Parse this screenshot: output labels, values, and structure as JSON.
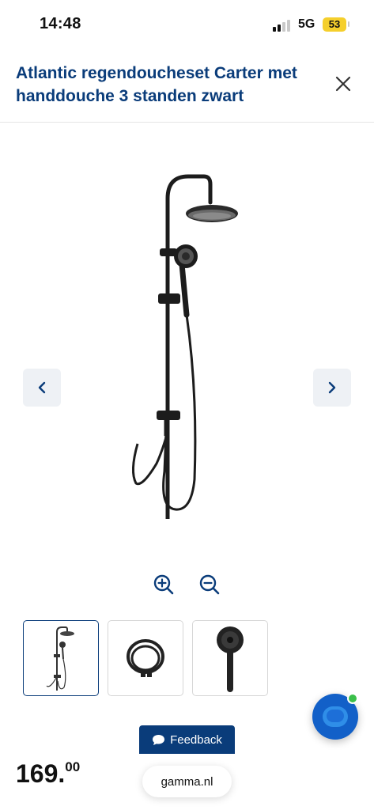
{
  "status_bar": {
    "time": "14:48",
    "network": "5G",
    "battery": "53"
  },
  "header": {
    "title": "Atlantic regendoucheset Carter met handdouche 3 standen zwart",
    "close_icon": "close-icon"
  },
  "gallery": {
    "prev_icon": "chevron-left-icon",
    "next_icon": "chevron-right-icon",
    "zoom_in_icon": "zoom-in-icon",
    "zoom_out_icon": "zoom-out-icon",
    "thumbnails": [
      "shower-set",
      "shower-hose",
      "hand-shower"
    ],
    "active_thumbnail": 0
  },
  "feedback": {
    "label": "Feedback",
    "icon": "chat-bubble-icon"
  },
  "price": {
    "integer": "169.",
    "decimals": "00"
  },
  "browser": {
    "url": "gamma.nl"
  },
  "colors": {
    "brand_blue": "#0a3c7a",
    "battery": "#f5cf2c",
    "chat_blue": "#1260c8",
    "online_dot": "#3bbf4a"
  }
}
